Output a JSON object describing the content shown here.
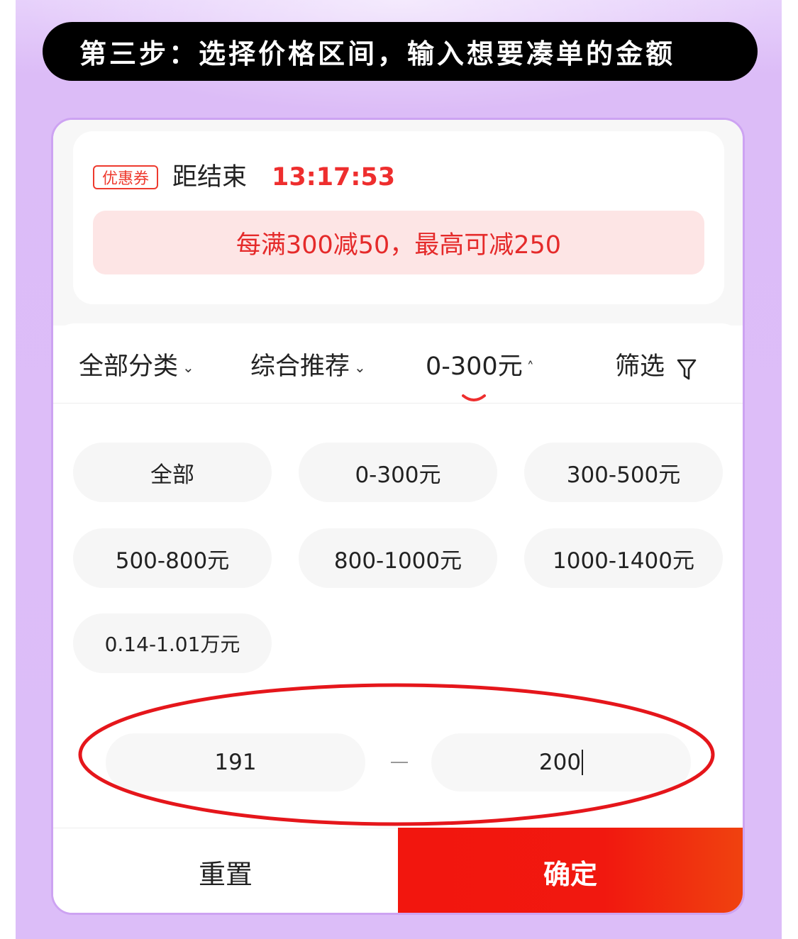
{
  "banner": {
    "text": "第三步：选择价格区间，输入想要凑单的金额"
  },
  "coupon": {
    "tag": "优惠券",
    "countdown_label": "距结束",
    "countdown_time": "13:17:53",
    "discount_text": "每满300减50，最高可减250"
  },
  "sort_bar": {
    "items": [
      {
        "label": "全部分类"
      },
      {
        "label": "综合推荐"
      },
      {
        "label": "0-300元"
      },
      {
        "label": "筛选"
      }
    ],
    "active_index": 2
  },
  "price_chips": [
    {
      "label": "全部"
    },
    {
      "label": "0-300元"
    },
    {
      "label": "300-500元"
    },
    {
      "label": "500-800元"
    },
    {
      "label": "800-1000元"
    },
    {
      "label": "1000-1400元"
    },
    {
      "label": "0.14-1.01万元"
    }
  ],
  "range": {
    "min_value": "191",
    "max_value": "200"
  },
  "actions": {
    "reset_label": "重置",
    "confirm_label": "确定"
  },
  "colors": {
    "accent": "#f2160e",
    "highlight_ellipse": "#e5161b",
    "background": "#dcbdf8"
  }
}
